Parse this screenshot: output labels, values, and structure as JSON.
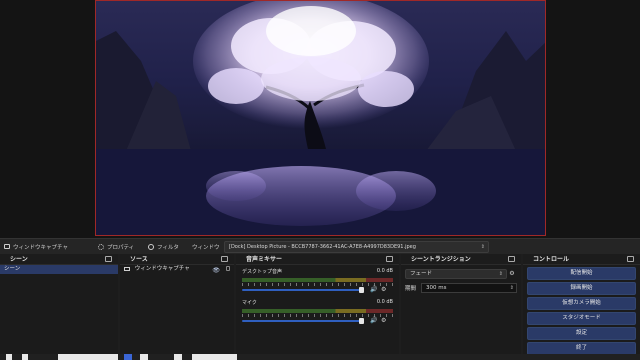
{
  "context_bar": {
    "window_capture": "ウィンドウキャプチャ",
    "properties": "プロパティ",
    "filters": "フィルタ",
    "window_label": "ウィンドウ",
    "selected_window": "[Dock] Desktop Picture - BCCB7787-3662-41AC-A7E8-A4997D83DE91.jpeg"
  },
  "docks": {
    "scenes": {
      "title": "シーン",
      "items": [
        "シーン"
      ]
    },
    "sources": {
      "title": "ソース",
      "items": [
        "ウィンドウキャプチャ"
      ]
    },
    "mixer": {
      "title": "音声ミキサー",
      "channels": [
        {
          "name": "デスクトップ音声",
          "db": "0.0 dB",
          "level": 1.0
        },
        {
          "name": "マイク",
          "db": "0.0 dB",
          "level": 1.0
        }
      ]
    },
    "transitions": {
      "title": "シーントランジション",
      "selected": "フェード",
      "duration_label": "期間",
      "duration_value": "300 ms"
    },
    "controls": {
      "title": "コントロール",
      "buttons": [
        "配信開始",
        "録画開始",
        "仮想カメラ開始",
        "スタジオモード",
        "設定",
        "終了"
      ]
    }
  },
  "colors": {
    "accent": "#2a3a67",
    "preview_border": "#a02828",
    "slider": "#2f5fbf"
  }
}
